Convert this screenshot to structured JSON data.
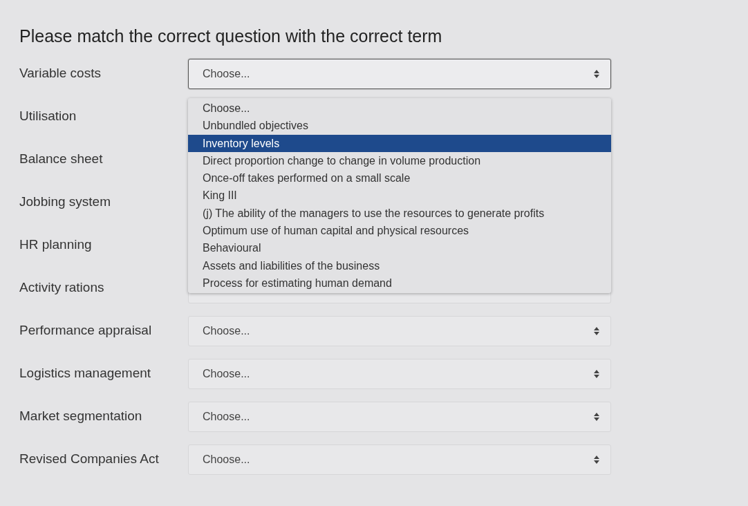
{
  "heading": "Please match the correct question with the correct term",
  "rows": [
    {
      "label": "Variable costs",
      "kind": "open",
      "value": "Choose..."
    },
    {
      "label": "Utilisation",
      "kind": "covered"
    },
    {
      "label": "Balance sheet",
      "kind": "covered"
    },
    {
      "label": "Jobbing system",
      "kind": "covered"
    },
    {
      "label": "HR planning",
      "kind": "covered"
    },
    {
      "label": "Activity rations",
      "kind": "partial"
    },
    {
      "label": "Performance appraisal",
      "kind": "closed",
      "value": "Choose..."
    },
    {
      "label": "Logistics management",
      "kind": "closed",
      "value": "Choose..."
    },
    {
      "label": "Market segmentation",
      "kind": "closed",
      "value": "Choose..."
    },
    {
      "label": "Revised Companies Act",
      "kind": "closed",
      "value": "Choose..."
    }
  ],
  "dropdown": {
    "options": [
      {
        "label": "Choose...",
        "selected": false
      },
      {
        "label": "Unbundled objectives",
        "selected": false
      },
      {
        "label": "Inventory levels",
        "selected": true
      },
      {
        "label": "Direct proportion change to change in volume production",
        "selected": false
      },
      {
        "label": "Once-off takes performed on a small scale",
        "selected": false
      },
      {
        "label": "King III",
        "selected": false
      },
      {
        "label": "(j) The ability of the managers to use the resources to generate profits",
        "selected": false
      },
      {
        "label": "Optimum use of human capital and physical resources",
        "selected": false
      },
      {
        "label": "Behavioural",
        "selected": false
      },
      {
        "label": "Assets and liabilities of the business",
        "selected": false
      },
      {
        "label": "Process for estimating human demand",
        "selected": false
      }
    ]
  }
}
